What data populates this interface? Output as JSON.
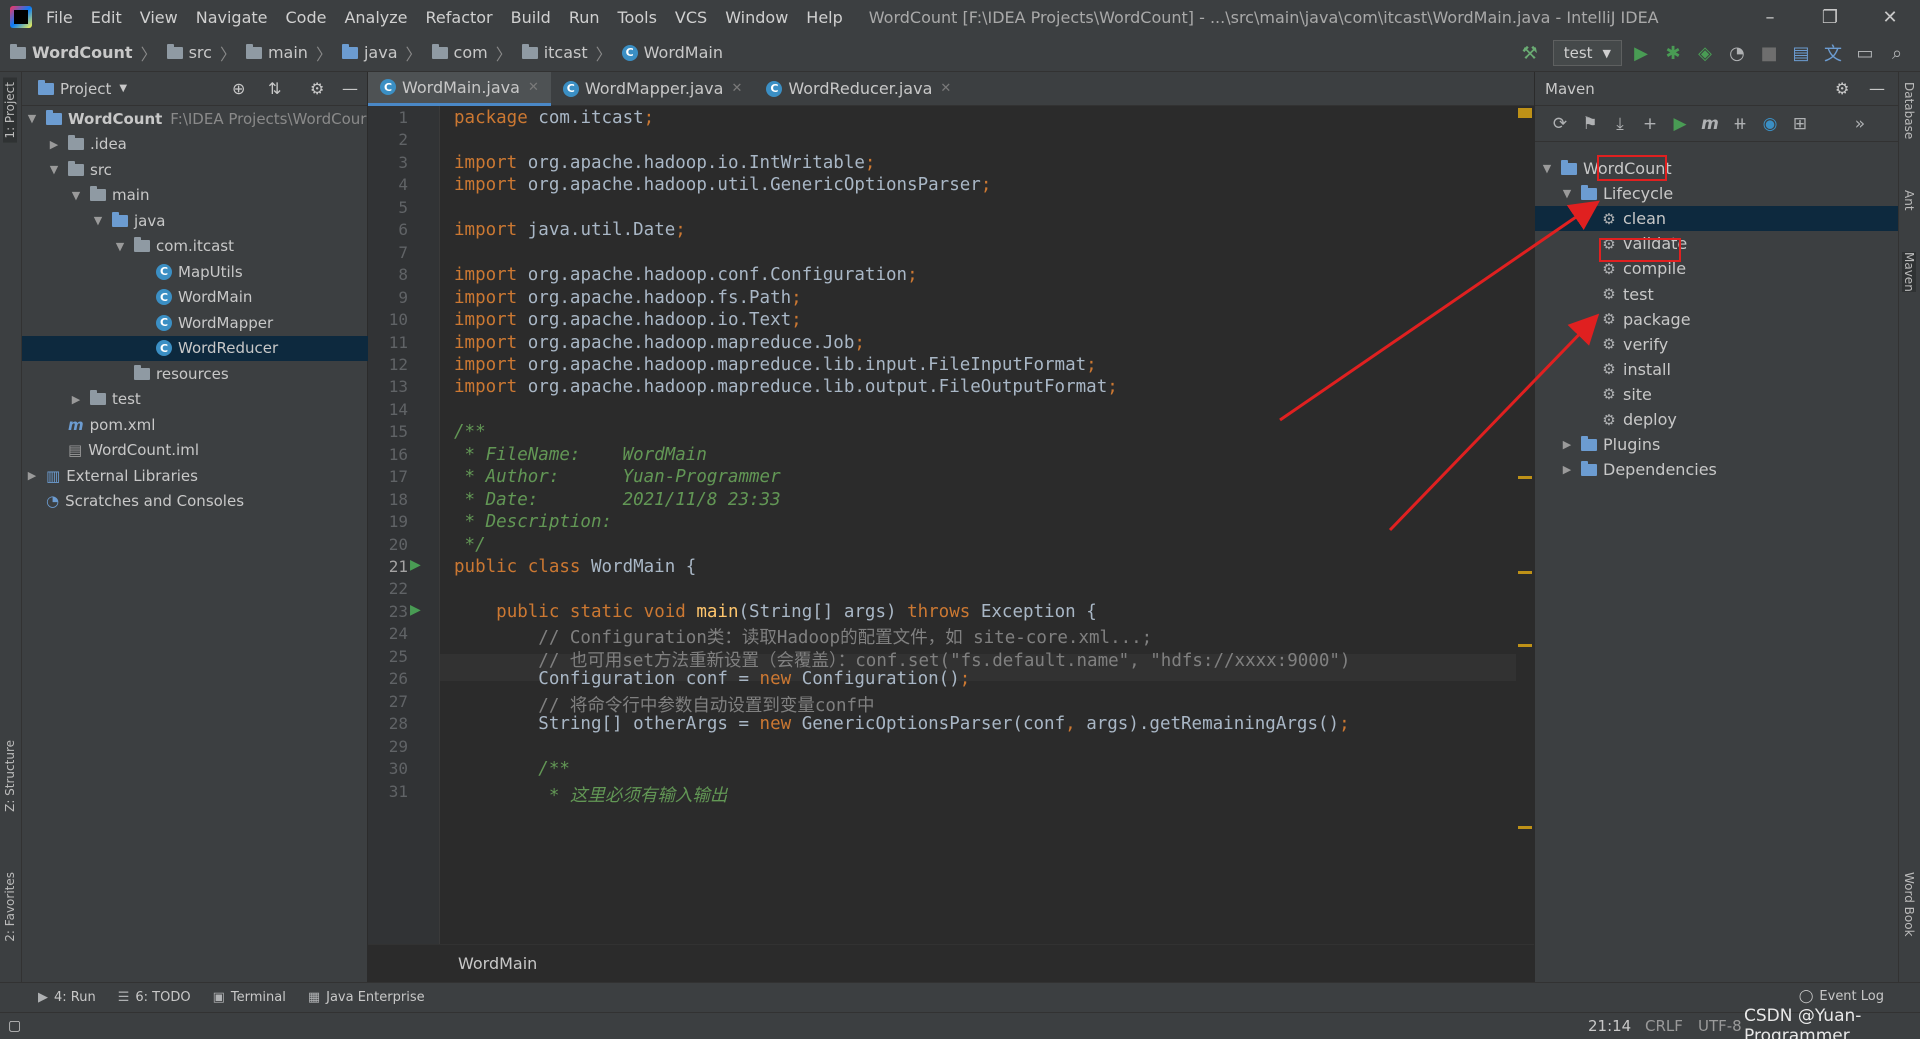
{
  "window": {
    "title": "WordCount [F:\\IDEA Projects\\WordCount] - ...\\src\\main\\java\\com\\itcast\\WordMain.java - IntelliJ IDEA",
    "minimize": "–",
    "restore": "❐",
    "close": "✕"
  },
  "menu": [
    "File",
    "Edit",
    "View",
    "Navigate",
    "Code",
    "Analyze",
    "Refactor",
    "Build",
    "Run",
    "Tools",
    "VCS",
    "Window",
    "Help"
  ],
  "breadcrumb": [
    "WordCount",
    "src",
    "main",
    "java",
    "com",
    "itcast",
    "WordMain"
  ],
  "run_config": "test",
  "left_tabs": {
    "project": "1: Project",
    "structure": "Z: Structure",
    "favorites": "2: Favorites"
  },
  "project_panel": {
    "title": "Project",
    "tree": [
      {
        "label": "WordCount",
        "path": "F:\\IDEA Projects\\WordCour",
        "arrow": "▼",
        "icon": "module"
      },
      {
        "label": ".idea",
        "arrow": "▶",
        "icon": "folder"
      },
      {
        "label": "src",
        "arrow": "▼",
        "icon": "folder"
      },
      {
        "label": "main",
        "arrow": "▼",
        "icon": "folder"
      },
      {
        "label": "java",
        "arrow": "▼",
        "icon": "folder-blue"
      },
      {
        "label": "com.itcast",
        "arrow": "▼",
        "icon": "package"
      },
      {
        "label": "MapUtils",
        "icon": "class"
      },
      {
        "label": "WordMain",
        "icon": "class"
      },
      {
        "label": "WordMapper",
        "icon": "class"
      },
      {
        "label": "WordReducer",
        "icon": "class",
        "selected": true
      },
      {
        "label": "resources",
        "icon": "folder"
      },
      {
        "label": "test",
        "arrow": "▶",
        "icon": "folder"
      },
      {
        "label": "pom.xml",
        "icon": "maven"
      },
      {
        "label": "WordCount.iml",
        "icon": "file"
      },
      {
        "label": "External Libraries",
        "arrow": "▶",
        "icon": "library"
      },
      {
        "label": "Scratches and Consoles",
        "icon": "scratch"
      }
    ]
  },
  "editor_tabs": [
    {
      "label": "WordMain.java",
      "active": true
    },
    {
      "label": "WordMapper.java"
    },
    {
      "label": "WordReducer.java"
    }
  ],
  "code": {
    "current_line": 21,
    "lines": [
      {
        "n": 1,
        "t": [
          [
            "kw",
            "package "
          ],
          [
            "",
            "com.itcast"
          ],
          [
            "kw",
            ";"
          ]
        ]
      },
      {
        "n": 2,
        "t": []
      },
      {
        "n": 3,
        "t": [
          [
            "kw",
            "import "
          ],
          [
            "",
            "org.apache.hadoop.io.IntWritable"
          ],
          [
            "kw",
            ";"
          ]
        ]
      },
      {
        "n": 4,
        "t": [
          [
            "kw",
            "import "
          ],
          [
            "",
            "org.apache.hadoop.util.GenericOptionsParser"
          ],
          [
            "kw",
            ";"
          ]
        ]
      },
      {
        "n": 5,
        "t": []
      },
      {
        "n": 6,
        "t": [
          [
            "kw",
            "import "
          ],
          [
            "",
            "java.util.Date"
          ],
          [
            "kw",
            ";"
          ]
        ]
      },
      {
        "n": 7,
        "t": []
      },
      {
        "n": 8,
        "t": [
          [
            "kw",
            "import "
          ],
          [
            "",
            "org.apache.hadoop.conf.Configuration"
          ],
          [
            "kw",
            ";"
          ]
        ]
      },
      {
        "n": 9,
        "t": [
          [
            "kw",
            "import "
          ],
          [
            "",
            "org.apache.hadoop.fs.Path"
          ],
          [
            "kw",
            ";"
          ]
        ]
      },
      {
        "n": 10,
        "t": [
          [
            "kw",
            "import "
          ],
          [
            "",
            "org.apache.hadoop.io.Text"
          ],
          [
            "kw",
            ";"
          ]
        ]
      },
      {
        "n": 11,
        "t": [
          [
            "kw",
            "import "
          ],
          [
            "",
            "org.apache.hadoop.mapreduce.Job"
          ],
          [
            "kw",
            ";"
          ]
        ]
      },
      {
        "n": 12,
        "t": [
          [
            "kw",
            "import "
          ],
          [
            "",
            "org.apache.hadoop.mapreduce.lib.input.FileInputFormat"
          ],
          [
            "kw",
            ";"
          ]
        ]
      },
      {
        "n": 13,
        "t": [
          [
            "kw",
            "import "
          ],
          [
            "",
            "org.apache.hadoop.mapreduce.lib.output.FileOutputFormat"
          ],
          [
            "kw",
            ";"
          ]
        ]
      },
      {
        "n": 14,
        "t": []
      },
      {
        "n": 15,
        "t": [
          [
            "dc",
            "/**"
          ]
        ]
      },
      {
        "n": 16,
        "t": [
          [
            "dc",
            " * FileName:    WordMain"
          ]
        ]
      },
      {
        "n": 17,
        "t": [
          [
            "dc",
            " * Author:      Yuan-Programmer"
          ]
        ]
      },
      {
        "n": 18,
        "t": [
          [
            "dc",
            " * Date:        2021/11/8 23:33"
          ]
        ]
      },
      {
        "n": 19,
        "t": [
          [
            "dc",
            " * Description:"
          ]
        ]
      },
      {
        "n": 20,
        "t": [
          [
            "dc",
            " */"
          ]
        ]
      },
      {
        "n": 21,
        "t": [
          [
            "kw",
            "public class "
          ],
          [
            "",
            "WordMain {"
          ]
        ]
      },
      {
        "n": 22,
        "t": []
      },
      {
        "n": 23,
        "t": [
          [
            "",
            "    "
          ],
          [
            "kw",
            "public static void "
          ],
          [
            "fn",
            "main"
          ],
          [
            "",
            "(String[] args) "
          ],
          [
            "kw",
            "throws "
          ],
          [
            "",
            "Exception {"
          ]
        ]
      },
      {
        "n": 24,
        "t": [
          [
            "cm",
            "        // Configuration类：读取Hadoop的配置文件，如 site-core.xml...;"
          ]
        ]
      },
      {
        "n": 25,
        "t": [
          [
            "cm",
            "        // 也可用set方法重新设置（会覆盖）：conf.set(\"fs.default.name\", \"hdfs://xxxx:9000\")"
          ]
        ]
      },
      {
        "n": 26,
        "t": [
          [
            "",
            "        Configuration conf = "
          ],
          [
            "kw",
            "new "
          ],
          [
            "",
            "Configuration()"
          ],
          [
            "kw",
            ";"
          ]
        ]
      },
      {
        "n": 27,
        "t": [
          [
            "cm",
            "        // 将命令行中参数自动设置到变量conf中"
          ]
        ]
      },
      {
        "n": 28,
        "t": [
          [
            "",
            "        String[] otherArgs = "
          ],
          [
            "kw",
            "new "
          ],
          [
            "",
            "GenericOptionsParser(conf"
          ],
          [
            "kw",
            ", "
          ],
          [
            "",
            "args).getRemainingArgs()"
          ],
          [
            "kw",
            ";"
          ]
        ]
      },
      {
        "n": 29,
        "t": []
      },
      {
        "n": 30,
        "t": [
          [
            "dc",
            "        /**"
          ]
        ]
      },
      {
        "n": 31,
        "t": [
          [
            "dc",
            "         * 这里必须有输入输出"
          ]
        ]
      }
    ]
  },
  "editor_footer": "WordMain",
  "maven": {
    "title": "Maven",
    "tree": [
      {
        "label": "WordCount",
        "arrow": "▼",
        "icon": "maven-project"
      },
      {
        "label": "Lifecycle",
        "arrow": "▼",
        "icon": "folder"
      },
      {
        "label": "clean",
        "icon": "gear",
        "selected": true
      },
      {
        "label": "validate",
        "icon": "gear"
      },
      {
        "label": "compile",
        "icon": "gear"
      },
      {
        "label": "test",
        "icon": "gear"
      },
      {
        "label": "package",
        "icon": "gear"
      },
      {
        "label": "verify",
        "icon": "gear"
      },
      {
        "label": "install",
        "icon": "gear"
      },
      {
        "label": "site",
        "icon": "gear"
      },
      {
        "label": "deploy",
        "icon": "gear"
      },
      {
        "label": "Plugins",
        "arrow": "▶",
        "icon": "folder"
      },
      {
        "label": "Dependencies",
        "arrow": "▶",
        "icon": "folder"
      }
    ]
  },
  "right_tabs": {
    "database": "Database",
    "ant": "Ant",
    "maven": "Maven",
    "wordbook": "Word Book"
  },
  "bottom_tabs": [
    {
      "label": "4: Run",
      "icon": "▶"
    },
    {
      "label": "6: TODO",
      "icon": "☰"
    },
    {
      "label": "Terminal",
      "icon": "▣"
    },
    {
      "label": "Java Enterprise",
      "icon": "▦"
    }
  ],
  "event_log": "Event Log",
  "status": {
    "position": "21:14",
    "line_sep": "CRLF",
    "encoding": "UTF-8",
    "watermark": "CSDN @Yuan-Programmer"
  },
  "colors": {
    "highlight_box": "#e02020",
    "selection": "#0d293e",
    "keyword": "#cc7832",
    "doc_comment": "#629755"
  }
}
